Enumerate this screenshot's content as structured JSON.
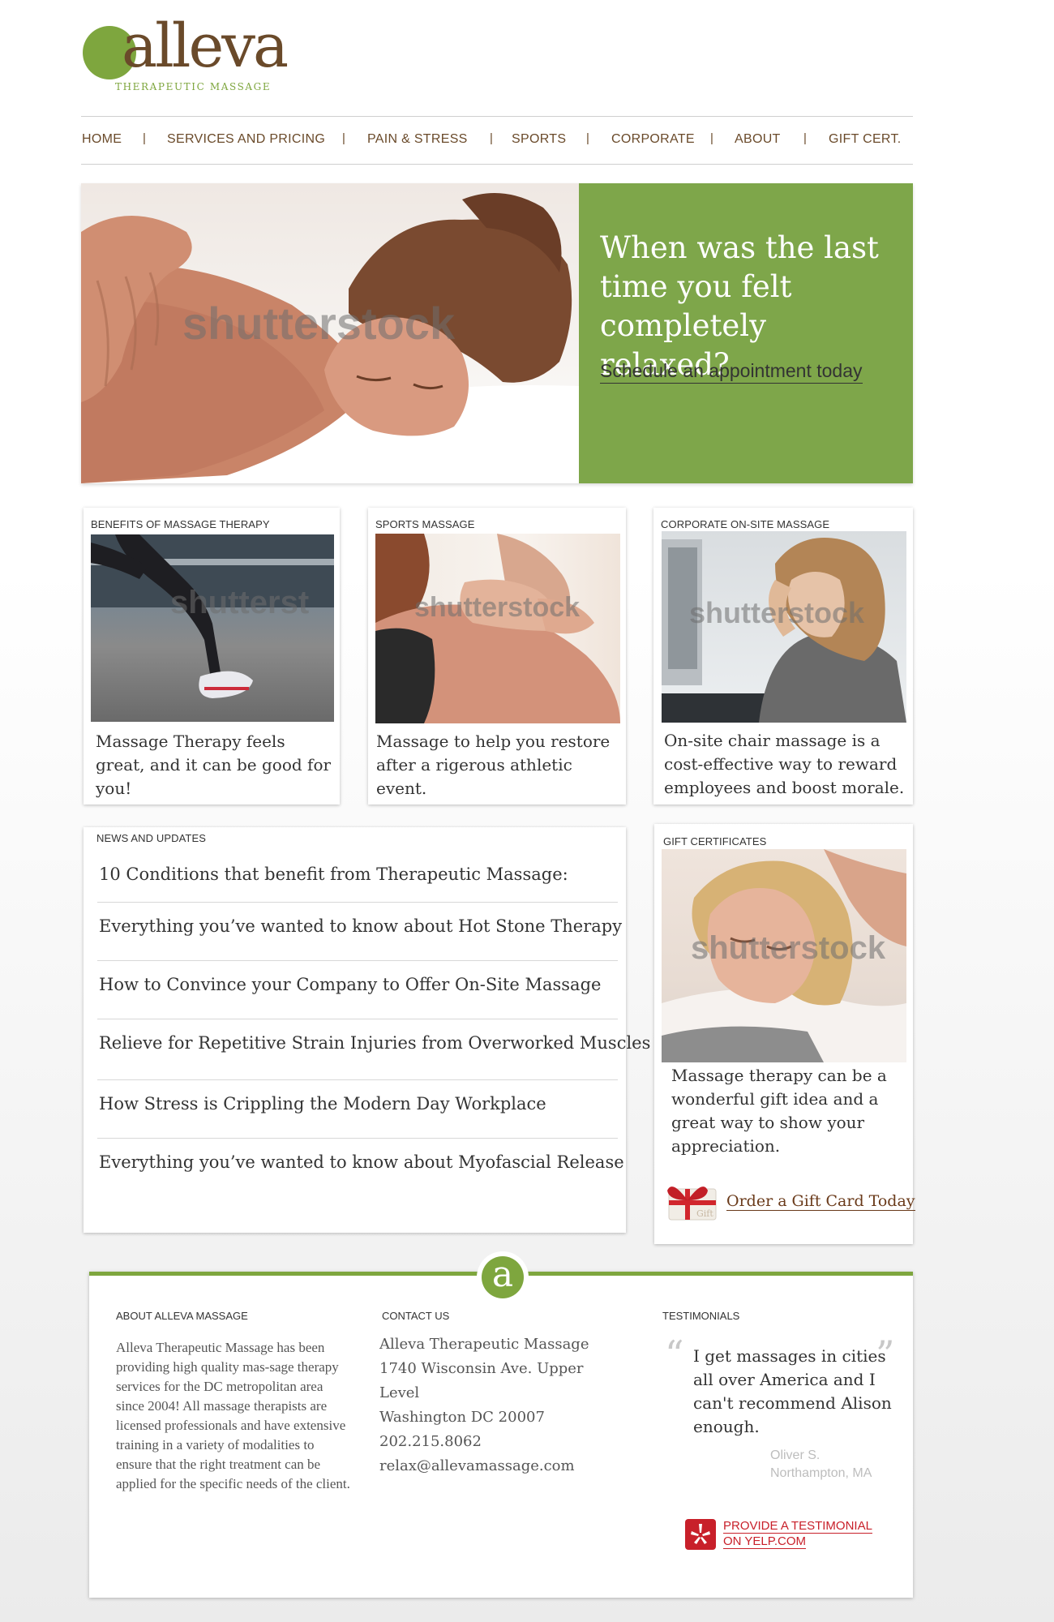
{
  "brand": {
    "name": "alleva",
    "tagline": "THERAPEUTIC MASSAGE",
    "accent_color": "#7ea63e",
    "brown_color": "#6a4a2a"
  },
  "nav": {
    "items": [
      {
        "label": "HOME"
      },
      {
        "label": "SERVICES AND PRICING"
      },
      {
        "label": "PAIN & STRESS"
      },
      {
        "label": "SPORTS"
      },
      {
        "label": "CORPORATE"
      },
      {
        "label": "ABOUT"
      },
      {
        "label": "GIFT CERT."
      }
    ],
    "separator": "|"
  },
  "hero": {
    "headline": "When was the last time you felt completely relaxed?",
    "cta": "Schedule an appointment today",
    "watermark": "shutterstock"
  },
  "cards": [
    {
      "label": "BENEFITS OF MASSAGE THERAPY",
      "text": "Massage Therapy feels great, and it can be good for you!",
      "watermark": "shutterst"
    },
    {
      "label": "SPORTS MASSAGE",
      "text": "Massage to help you restore after a rigerous athletic event.",
      "watermark": "shutterstock"
    },
    {
      "label": "CORPORATE ON-SITE MASSAGE",
      "text": "On-site chair massage is a cost-effective way to reward employees and boost morale.",
      "watermark": "shutterstock"
    }
  ],
  "news": {
    "label": "NEWS AND UPDATES",
    "items": [
      "10 Conditions that benefit from Therapeutic Massage:",
      "Everything you’ve wanted to know about Hot Stone Therapy",
      "How to Convince your Company to Offer On-Site Massage",
      "Relieve for Repetitive Strain Injuries from Overworked Muscles",
      "How Stress is Crippling the Modern Day Workplace",
      "Everything you’ve wanted to know about Myofascial Release"
    ]
  },
  "gift": {
    "label": "GIFT CERTIFICATES",
    "text": "Massage therapy can be a wonderful gift idea and a great way to show your appreciation.",
    "link": "Order a Gift Card Today",
    "watermark": "shutterstock",
    "card_word": "Gift"
  },
  "footer": {
    "badge_letter": "a",
    "about": {
      "heading": "ABOUT ALLEVA MASSAGE",
      "text": "Alleva Therapeutic Massage has been providing high quality mas-sage therapy services for the DC metropolitan area since 2004!   All massage therapists are licensed professionals and have extensive training in a variety of modalities to ensure that the right treatment can be applied for the specific needs of the client."
    },
    "contact": {
      "heading": "CONTACT US",
      "name": "Alleva Therapeutic Massage",
      "address1": "1740 Wisconsin Ave. Upper",
      "address2": "Level",
      "city": "Washington DC 20007",
      "phone": "202.215.8062",
      "email": "relax@allevamassage.com"
    },
    "testimonials": {
      "heading": "TESTIMONIALS",
      "quote": "I get massages in cities all over America and I can't recommend Alison enough.",
      "author": "Oliver S.",
      "location": "Northampton, MA",
      "yelp_line1": "PROVIDE A TESTIMONIAL",
      "yelp_line2": "ON YELP.COM"
    }
  }
}
